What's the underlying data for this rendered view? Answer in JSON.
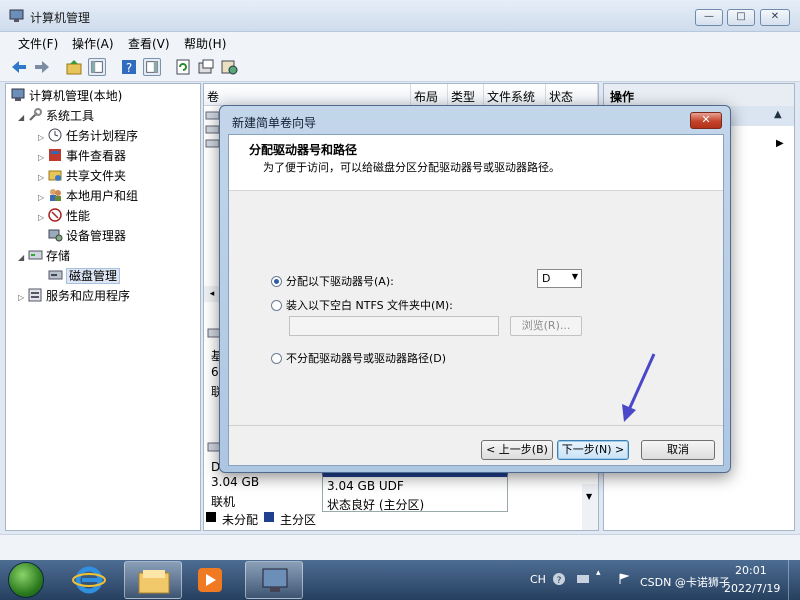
{
  "window": {
    "title": "计算机管理"
  },
  "window_buttons": {
    "minimize": "—",
    "restore": "□",
    "close": "✕"
  },
  "menu": [
    "文件(F)",
    "操作(A)",
    "查看(V)",
    "帮助(H)"
  ],
  "tree": {
    "root": "计算机管理(本地)",
    "system_tools": "系统工具",
    "task_scheduler": "任务计划程序",
    "event_viewer": "事件查看器",
    "shared_folders": "共享文件夹",
    "local_users": "本地用户和组",
    "performance": "性能",
    "device_manager": "设备管理器",
    "storage": "存储",
    "disk_management": "磁盘管理",
    "services_apps": "服务和应用程序"
  },
  "volume_columns": {
    "volume": "卷",
    "layout": "布局",
    "type": "类型",
    "filesystem": "文件系统",
    "status": "状态"
  },
  "disk_partial": {
    "a": "基",
    "b": "6",
    "c": "联",
    "d": "D"
  },
  "disk_bottom": {
    "size": "3.04 GB",
    "state": "联机",
    "part_size": "3.04 GB UDF",
    "part_status": "状态良好 (主分区)"
  },
  "legend": {
    "unallocated": "未分配",
    "primary": "主分区"
  },
  "actions_header": "操作",
  "dialog": {
    "title": "新建简单卷向导",
    "header_title": "分配驱动器号和路径",
    "header_subtitle": "为了便于访问，可以给磁盘分区分配驱动器号或驱动器路径。",
    "option_assign": "分配以下驱动器号(A):",
    "option_mount": "装入以下空白 NTFS 文件夹中(M):",
    "option_none": "不分配驱动器号或驱动器路径(D)",
    "drive_letter": "D",
    "browse": "浏览(R)...",
    "back": "< 上一步(B)",
    "next": "下一步(N) >",
    "cancel": "取消",
    "close": "✕"
  },
  "tray": {
    "lang": "CH",
    "time": "20:01",
    "date": "2022/7/19",
    "watermark": "CSDN @卡诺狮子"
  },
  "colors": {
    "accent": "#2a5ca8",
    "annotation": "#4a48c9"
  }
}
